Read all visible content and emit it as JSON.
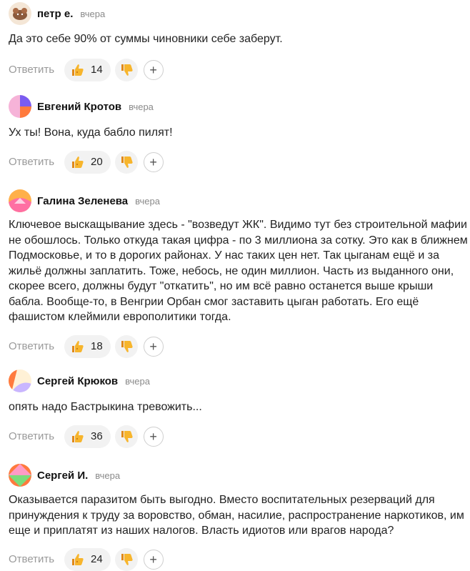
{
  "comments": [
    {
      "author": "петр е.",
      "time": "вчера",
      "text": "Да это себе 90% от суммы чиновники себе заберут.",
      "reply_label": "Ответить",
      "likes": "14"
    },
    {
      "author": "Евгений Кротов",
      "time": "вчера",
      "text": "Ух ты! Вона, куда бабло пилят!",
      "reply_label": "Ответить",
      "likes": "20"
    },
    {
      "author": "Галина Зеленева",
      "time": "вчера",
      "text": "Ключевое выскащывание здесь - \"возведут ЖК\". Видимо тут без строительной мафии не обошлось. Только откуда такая цифра - по 3 миллиона за сотку. Это как в ближнем Подмосковье, и то в дорогих районах. У нас таких цен нет. Так цыганам ещё и за жильё должны заплатить. Тоже, небось, не один миллион. Часть из выданного они, скорее всего, должны будут \"откатить\", но им всё равно останется выше крыши бабла. Вообще-то, в Венгрии Орбан смог заставить цыган работать. Его ещё фашистом клеймили европолитики тогда.",
      "reply_label": "Ответить",
      "likes": "18"
    },
    {
      "author": "Сергей Крюков",
      "time": "вчера",
      "text": "опять надо Бастрыкина тревожить...",
      "reply_label": "Ответить",
      "likes": "36"
    },
    {
      "author": "Сергей И.",
      "time": "вчера",
      "text": "Оказывается паразитом быть выгодно. Вместо воспитательных резерваций для принуждения к труду за воровство, обман, насилие, распространение наркотиков, им еще и приплатят из наших налогов. Власть идиотов или врагов народа?",
      "reply_label": "Ответить",
      "likes": "24"
    }
  ],
  "icons": {
    "like": "thumbs-up-icon",
    "dislike": "thumbs-down-icon",
    "more": "plus-icon"
  },
  "colors": {
    "thumb": "#f5a623",
    "button_bg": "#f2f2f2",
    "reply_text": "#9a9a9a"
  }
}
